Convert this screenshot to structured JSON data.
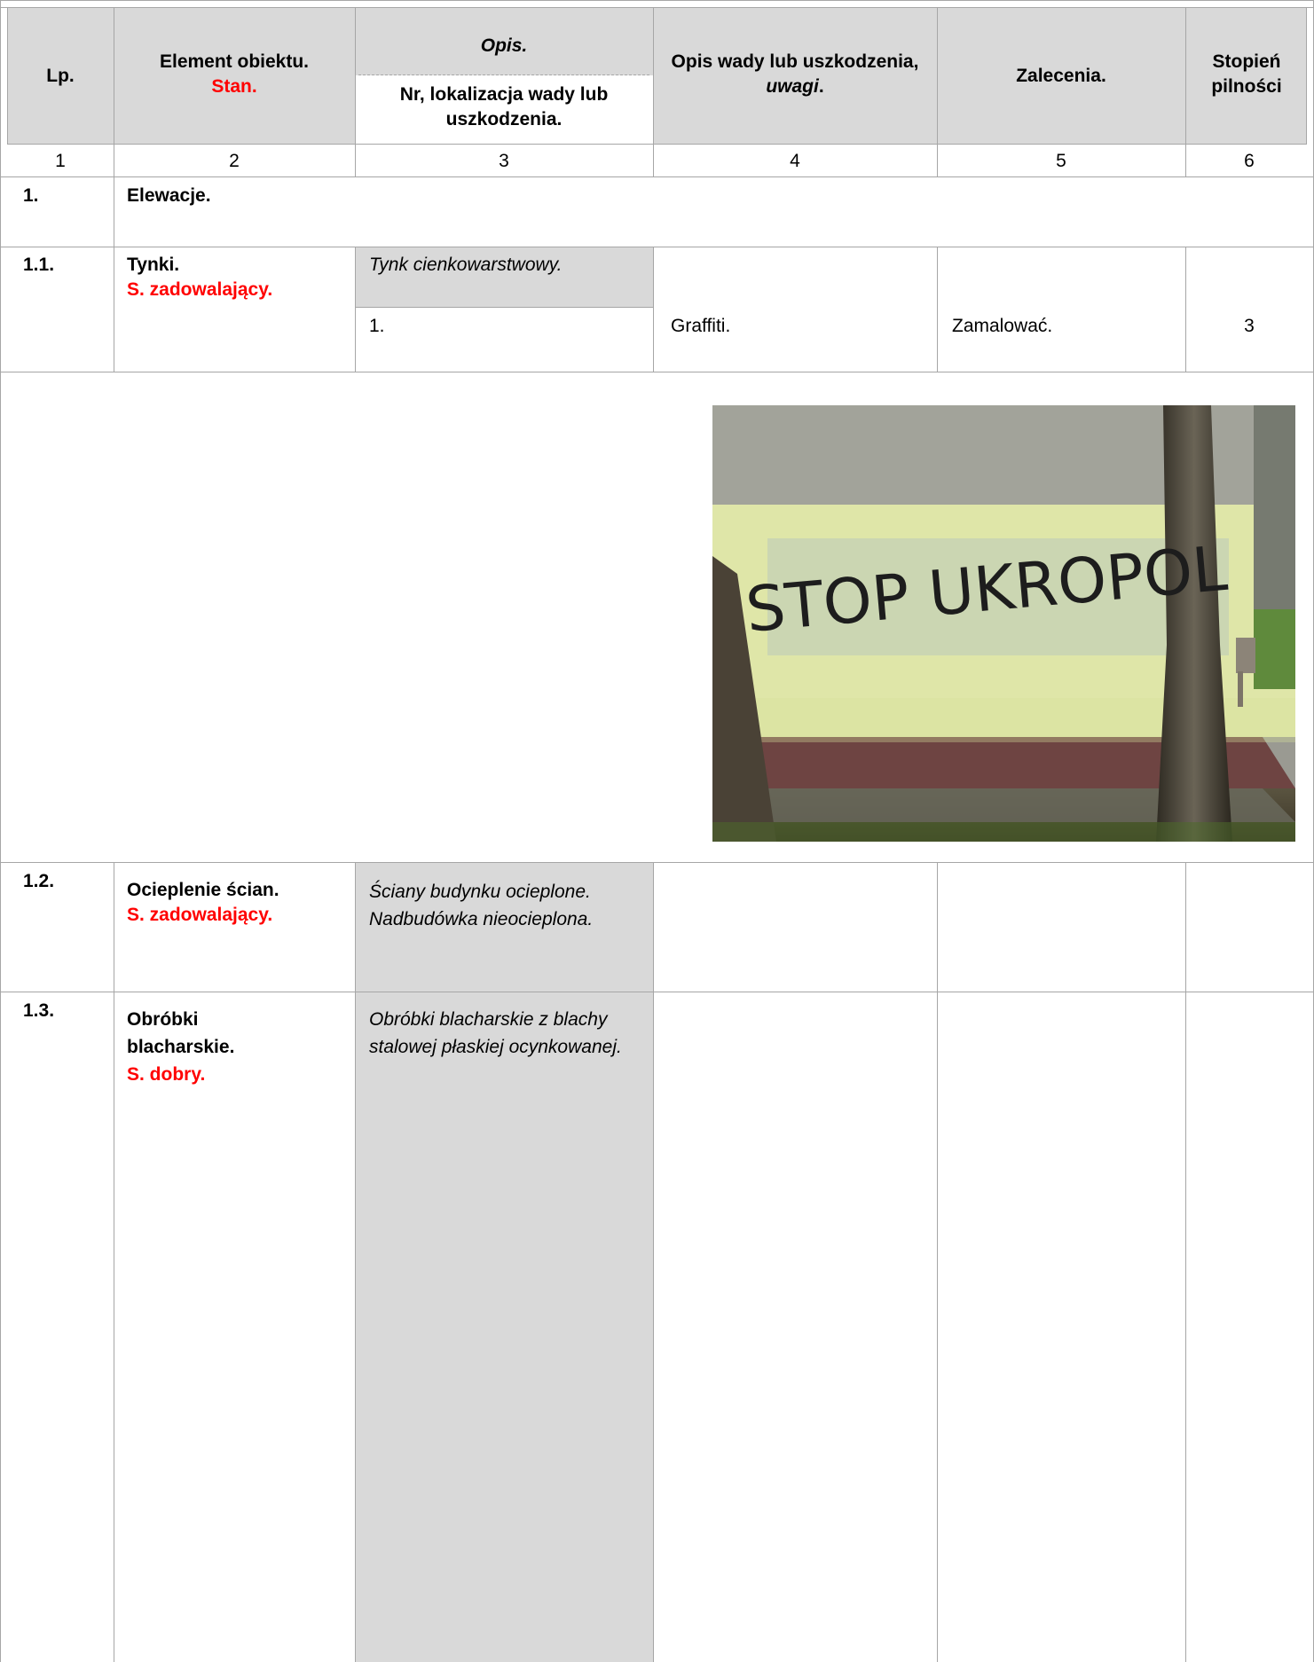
{
  "header": {
    "lp": "Lp.",
    "element": "Element obiektu.",
    "stan": "Stan.",
    "opis": "Opis.",
    "nr": "Nr, lokalizacja wady lub uszkodzenia.",
    "wada_part1": "Opis wady lub uszkodzenia, ",
    "wada_italic": "uwagi",
    "wada_end": ".",
    "zalecenia": "Zalecenia.",
    "stopien": "Stopień pilności"
  },
  "col_numbers": [
    "1",
    "2",
    "3",
    "4",
    "5",
    "6"
  ],
  "section": {
    "num": "1.",
    "title": "Elewacje."
  },
  "rows": [
    {
      "num": "1.1.",
      "element": "Tynki.",
      "state": "S. zadowalający.",
      "desc": "Tynk cienkowarstwowy.",
      "sub_nr": "1.",
      "defect": "Graffiti.",
      "recommend": "Zamalować.",
      "priority": "3"
    },
    {
      "num": "1.2.",
      "element": "Ocieplenie ścian.",
      "state": "S. zadowalający.",
      "desc": "Ściany budynku ocieplone. Nadbudówka nieocieplona."
    },
    {
      "num": "1.3.",
      "element": "Obróbki blacharskie.",
      "state": "S. dobry.",
      "desc": "Obróbki blacharskie z blachy stalowej płaskiej ocynkowanej."
    }
  ],
  "photo": {
    "graffiti_text": "STOP UKROPOL"
  },
  "colors": {
    "grid": "#a6a6a6",
    "header_bg": "#d9d9d9",
    "state_red": "#ff0000"
  }
}
